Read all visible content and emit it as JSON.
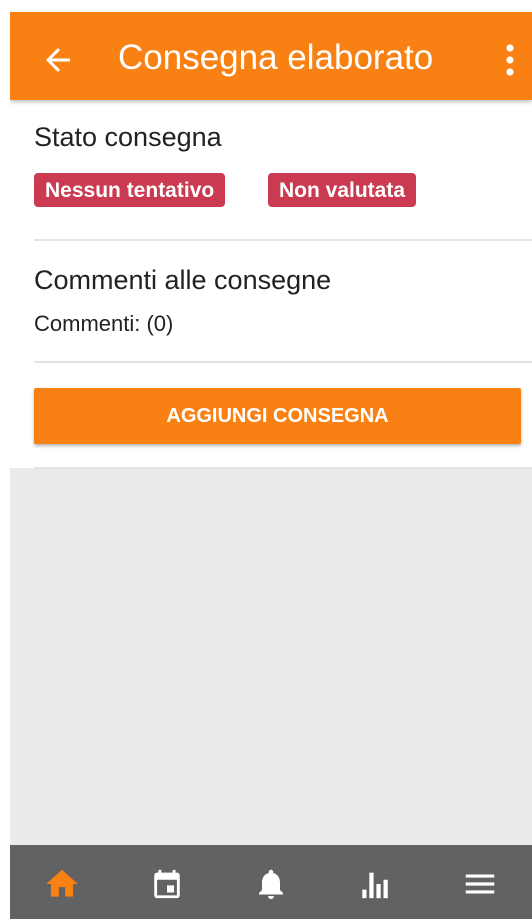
{
  "app_bar": {
    "back_icon": "arrow-back-icon",
    "title": "Consegna elaborato",
    "more_icon": "more-vert-icon",
    "color": "#f98012"
  },
  "status": {
    "heading": "Stato consegna",
    "badges": [
      "Nessun tentativo",
      "Non valutata"
    ],
    "badge_color": "#ca3a50"
  },
  "comments": {
    "heading": "Commenti alle consegne",
    "count_label": "Commenti: (0)"
  },
  "actions": {
    "add_submission_label": "AGGIUNGI CONSEGNA"
  },
  "bottom_nav": {
    "items": [
      {
        "icon": "home-icon",
        "active": true
      },
      {
        "icon": "calendar-icon",
        "active": false
      },
      {
        "icon": "bell-icon",
        "active": false
      },
      {
        "icon": "bar-chart-icon",
        "active": false
      },
      {
        "icon": "menu-icon",
        "active": false
      }
    ],
    "active_color": "#f98012",
    "background": "#626262"
  }
}
